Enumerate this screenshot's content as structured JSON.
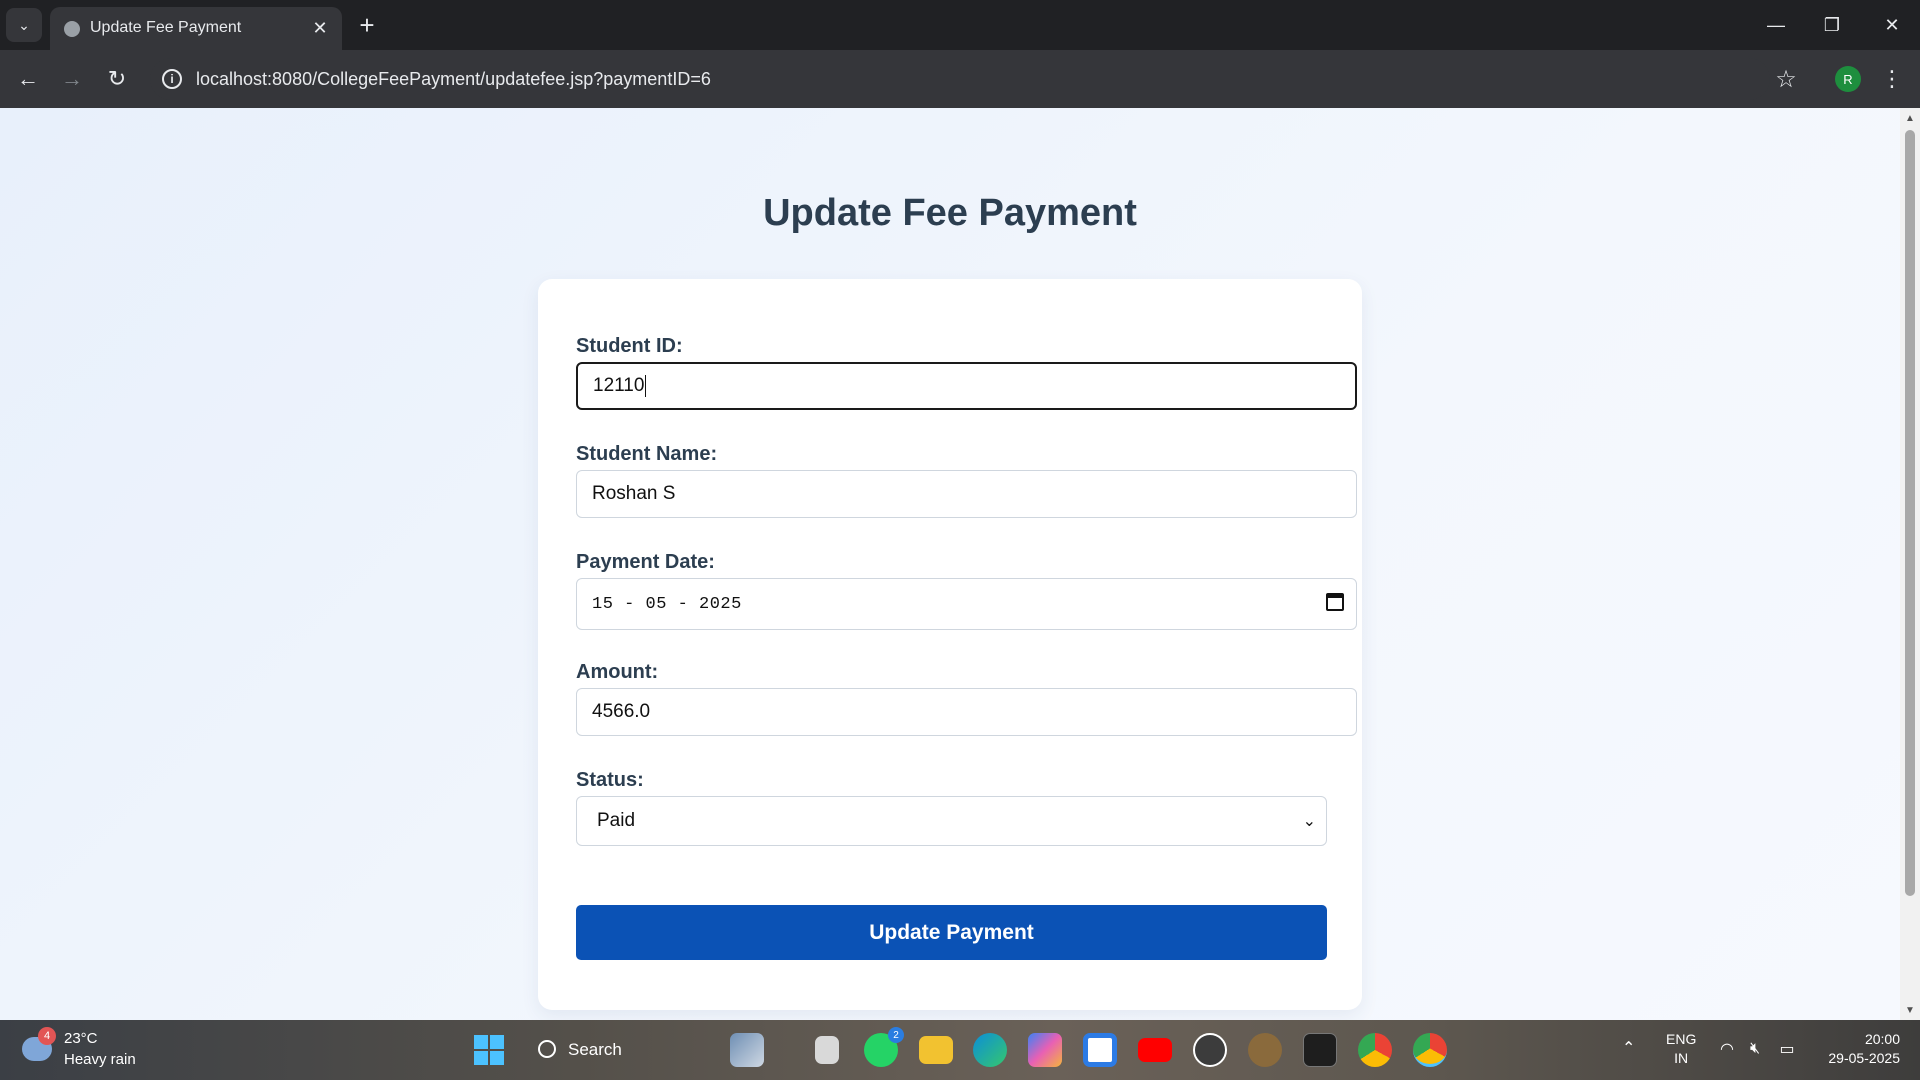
{
  "browser": {
    "tab_title": "Update Fee Payment",
    "url": "localhost:8080/CollegeFeePayment/updatefee.jsp?paymentID=6",
    "profile_initial": "R"
  },
  "page": {
    "title": "Update Fee Payment",
    "fields": {
      "student_id": {
        "label": "Student ID:",
        "value": "12110"
      },
      "student_name": {
        "label": "Student Name:",
        "value": "Roshan S"
      },
      "payment_date": {
        "label": "Payment Date:",
        "value": "15 - 05 - 2025"
      },
      "amount": {
        "label": "Amount:",
        "value": "4566.0"
      },
      "status": {
        "label": "Status:",
        "value": "Paid"
      }
    },
    "submit_label": "Update Payment"
  },
  "taskbar": {
    "weather": {
      "temp": "23°C",
      "desc": "Heavy rain",
      "badge": "4"
    },
    "search_label": "Search",
    "whatsapp_badge": "2",
    "tray": {
      "lang_top": "ENG",
      "lang_bottom": "IN"
    },
    "clock": {
      "time": "20:00",
      "date": "29-05-2025"
    }
  },
  "colors": {
    "accent": "#0b52b5",
    "heading": "#2c3e50",
    "page_bg": "#eef4fc"
  },
  "icons": [
    "chevron-down-icon",
    "globe-icon",
    "close-icon",
    "plus-icon",
    "minimize-icon",
    "restore-icon",
    "back-arrow-icon",
    "forward-arrow-icon",
    "reload-icon",
    "info-icon",
    "star-icon",
    "kebab-icon",
    "calendar-icon",
    "windows-start-icon",
    "search-icon"
  ]
}
